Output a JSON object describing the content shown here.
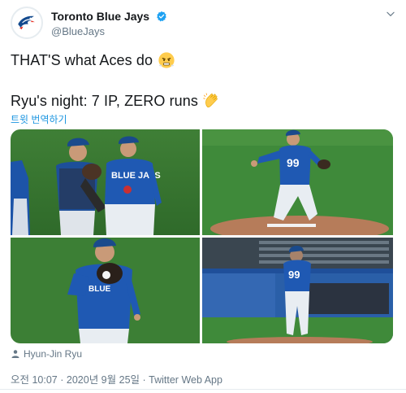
{
  "author": {
    "display_name": "Toronto Blue Jays",
    "handle": "@BlueJays",
    "verified": true
  },
  "tweet": {
    "line1": "THAT'S what Aces do",
    "line1_emoji": "face-with-steam-from-nose",
    "line2": "Ryu's night: 7 IP, ZERO runs",
    "line2_emoji": "clapping-hands",
    "translate_label": "트윗 번역하기"
  },
  "media": {
    "photo_count": 4,
    "tagged_person": "Hyun-Jin Ryu"
  },
  "meta": {
    "time": "오전 10:07",
    "date": "2020년 9월 25일",
    "separator": "·",
    "source": "Twitter Web App"
  },
  "colors": {
    "link": "#1b95e0",
    "secondary_text": "#657786",
    "jays_blue": "#134a8e",
    "field_green": "#3f8a3a"
  }
}
